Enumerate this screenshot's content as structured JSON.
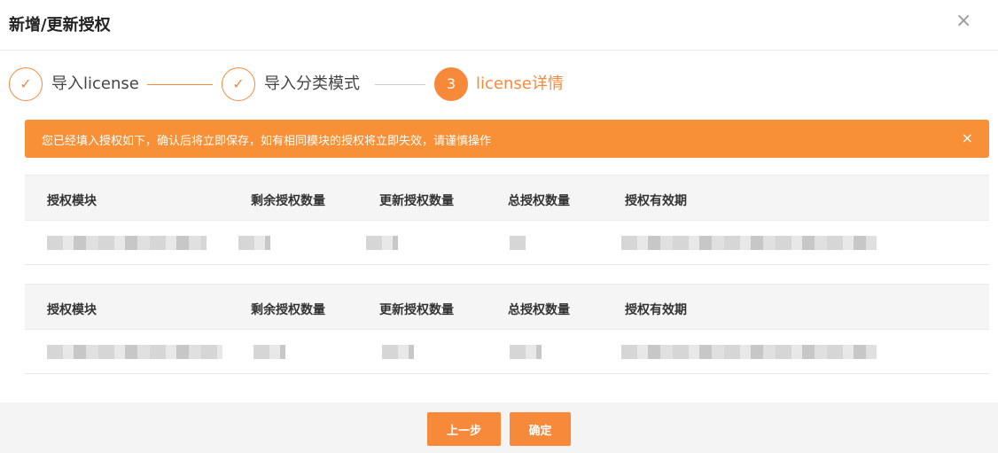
{
  "dialog": {
    "title": "新增/更新授权",
    "close_glyph": "×"
  },
  "steps": [
    {
      "label": "导入license",
      "icon": "check-icon",
      "glyph": "✓",
      "status": "done"
    },
    {
      "label": "导入分类模式",
      "icon": "check-icon",
      "glyph": "✓",
      "status": "done"
    },
    {
      "label": "license详情",
      "number": "3",
      "status": "active"
    }
  ],
  "alert": {
    "text": "您已经填入授权如下，确认后将立即保存，如有相同模块的授权将立即失效，请谨慎操作",
    "close_glyph": "×"
  },
  "table": {
    "columns": [
      "授权模块",
      "剩余授权数量",
      "更新授权数量",
      "总授权数量",
      "授权有效期"
    ]
  },
  "footer": {
    "prev_label": "上一步",
    "confirm_label": "确定"
  },
  "colors": {
    "accent": "#f7893b",
    "alert_bg": "#f89037",
    "line_done": "#f7893b",
    "line_pending": "#cccccc"
  }
}
